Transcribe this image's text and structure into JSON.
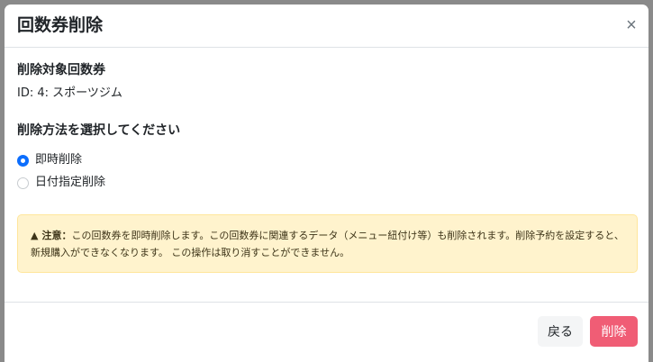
{
  "modal": {
    "title": "回数券削除",
    "close_label": "×"
  },
  "target": {
    "heading": "削除対象回数券",
    "value": "ID: 4: スポーツジム"
  },
  "method": {
    "heading": "削除方法を選択してください",
    "options": [
      {
        "label": "即時削除",
        "checked": true
      },
      {
        "label": "日付指定削除",
        "checked": false
      }
    ]
  },
  "alert": {
    "icon": "warning-triangle-icon",
    "prefix": "注意：",
    "text": "この回数券を即時削除します。この回数券に関連するデータ（メニュー紐付け等）も削除されます。削除予約を設定すると、新規購入ができなくなります。 この操作は取り消すことができません。"
  },
  "footer": {
    "back_label": "戻る",
    "delete_label": "削除"
  },
  "colors": {
    "primary": "#0d6efd",
    "danger": "#f05d75",
    "alert_bg": "#fff3cd",
    "alert_border": "#ffe69c"
  }
}
